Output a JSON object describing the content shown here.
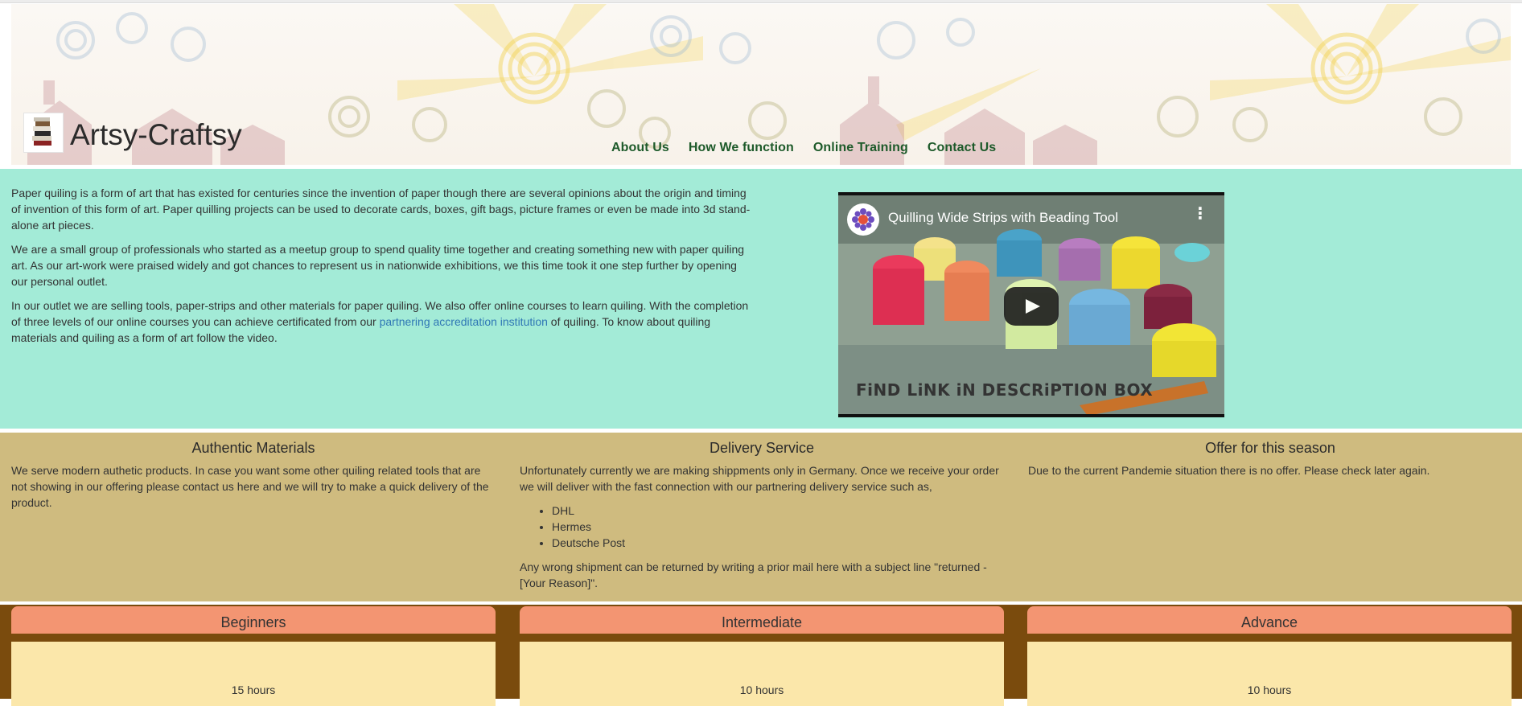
{
  "header": {
    "site_name": "Artsy-Craftsy",
    "nav": [
      "About Us",
      "How We function",
      "Online Training",
      "Contact Us"
    ]
  },
  "intro": {
    "paragraphs": [
      "Paper quiling is a form of art that has existed for centuries since the invention of paper though there are several opinions about the origin and timing of invention of this form of art. Paper quilling projects can be used to decorate cards, boxes, gift bags, picture frames or even be made into 3d stand-alone art pieces.",
      "We are a small group of professionals who started as a meetup group to spend quality time together and creating something new with paper quiling art. As our art-work were praised widely and got chances to represent us in nationwide exhibitions, we this time took it one step further by opening our personal outlet."
    ],
    "p3_before": "In our outlet we are selling tools, paper-strips and other materials for paper quiling. We also offer online courses to learn quiling. With the completion of three levels of our online courses you can achieve certificated from our ",
    "p3_link": "partnering accreditation institution",
    "p3_after": " of quiling. To know about quiling materials and quiling as a form of art follow the video."
  },
  "video": {
    "title": "Quilling Wide Strips with Beading Tool",
    "caption": "FiND LiNK iN DESCRiPTION BOX"
  },
  "features": {
    "materials": {
      "title": "Authentic Materials",
      "text": "We serve modern authetic products. In case you want some other quiling related tools that are not showing in our offering please contact us here and we will try to make a quick delivery of the product."
    },
    "delivery": {
      "title": "Delivery Service",
      "text": "Unfortunately currently we are making shippments only in Germany. Once we receive your order we will deliver with the fast connection with our partnering delivery service such as,",
      "carriers": [
        "DHL",
        "Hermes",
        "Deutsche Post"
      ],
      "note": "Any wrong shipment can be returned by writing a prior mail here with a subject line \"returned - [Your Reason]\"."
    },
    "offer": {
      "title": "Offer for this season",
      "text": "Due to the current Pandemie situation there is no offer. Please check later again."
    }
  },
  "courses": [
    {
      "level": "Beginners",
      "duration": "15 hours"
    },
    {
      "level": "Intermediate",
      "duration": "10 hours"
    },
    {
      "level": "Advance",
      "duration": "10 hours"
    }
  ],
  "colors": {
    "nav": "#1d5a2a",
    "intro_bg": "#a3ebd7",
    "features_bg": "#cfbb7f",
    "courses_bg": "#7a4b0d",
    "card_head": "#f39572",
    "card_body": "#fbe7aa",
    "link": "#2f77b5"
  }
}
